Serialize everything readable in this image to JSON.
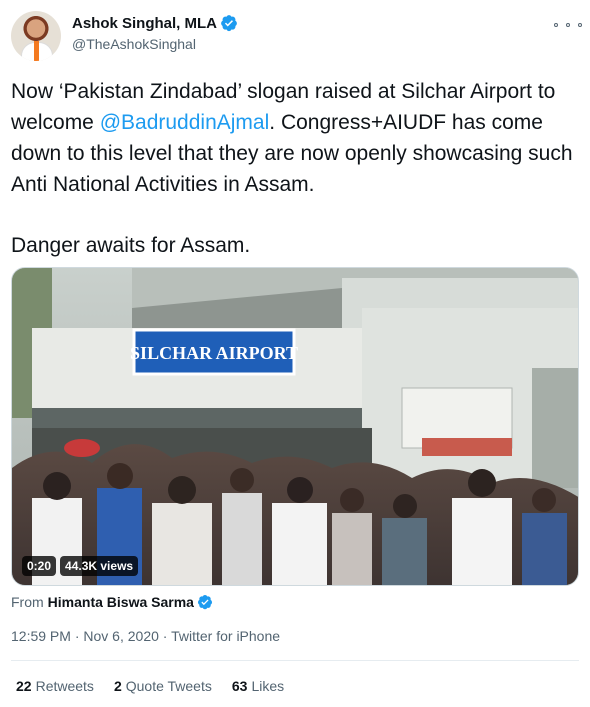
{
  "author": {
    "display_name": "Ashok Singhal, MLA",
    "handle": "@TheAshokSinghal"
  },
  "tweet": {
    "line1_before": "Now ‘Pakistan Zindabad’ slogan raised at Silchar Airport to welcome ",
    "mention": "@BadruddinAjmal",
    "line1_after": ". Congress+AIUDF has come down to this level that they are now openly showcasing such Anti National Activities in Assam.",
    "line2": "Danger awaits for Assam."
  },
  "media": {
    "sign_text": "SILCHAR AIRPORT",
    "duration": "0:20",
    "views": "44.3K views"
  },
  "source": {
    "from_label": "From",
    "from_name": "Himanta Biswa Sarma"
  },
  "meta": {
    "time": "12:59 PM",
    "date": "Nov 6, 2020",
    "client": "Twitter for iPhone",
    "separator": " · "
  },
  "stats": {
    "retweets_count": "22",
    "retweets_label": "Retweets",
    "quotes_count": "2",
    "quotes_label": "Quote Tweets",
    "likes_count": "63",
    "likes_label": "Likes"
  },
  "colors": {
    "accent": "#1d9bf0",
    "text_primary": "#0f1419",
    "text_secondary": "#536471"
  },
  "icons": {
    "verified": "verified-badge-icon",
    "more": "more-dots-icon"
  }
}
